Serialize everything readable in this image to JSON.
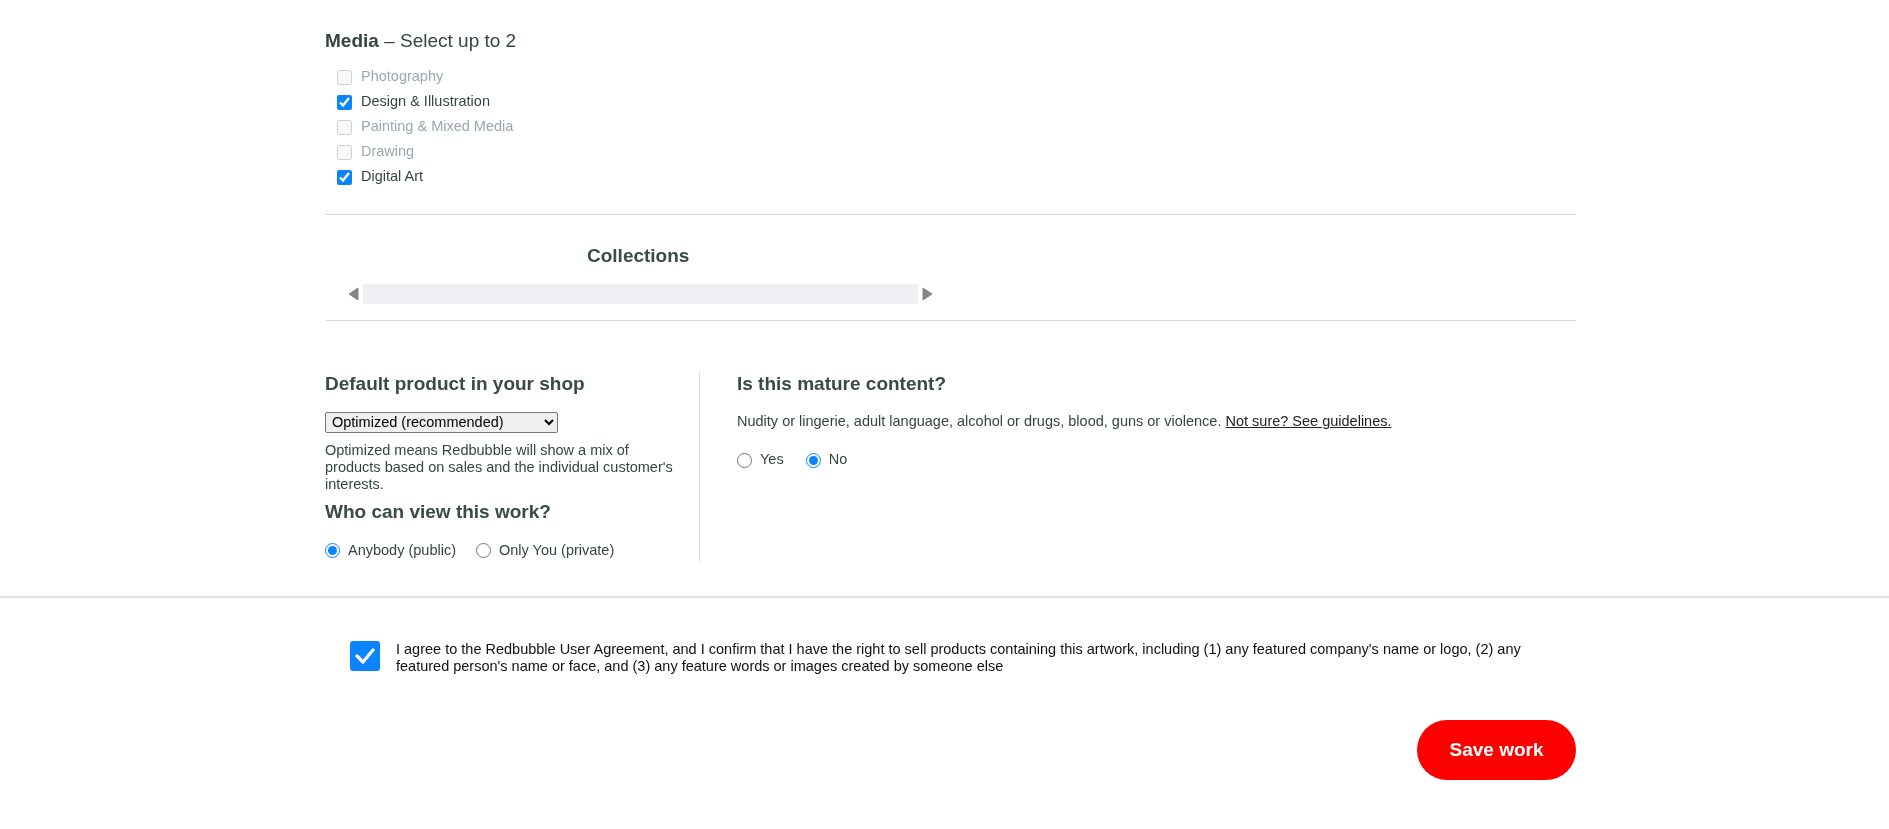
{
  "media": {
    "heading": "**Media** – Select up to 2",
    "options": [
      {
        "label": "Photography",
        "checked": false,
        "disabled": true
      },
      {
        "label": "Design & Illustration",
        "checked": true,
        "disabled": false
      },
      {
        "label": "Painting & Mixed Media",
        "checked": false,
        "disabled": true
      },
      {
        "label": "Drawing",
        "checked": false,
        "disabled": true
      },
      {
        "label": "Digital Art",
        "checked": true,
        "disabled": false
      }
    ]
  },
  "collections": {
    "heading": "Collections"
  },
  "default_product": {
    "heading": "Default product in your shop",
    "select_value": "Optimized (recommended)",
    "help": "Optimized means Redbubble will show a mix of products based on sales and the individual customer's interests."
  },
  "visibility": {
    "heading": "Who can view this work?",
    "options": [
      {
        "label": "Anybody (public)",
        "selected": true
      },
      {
        "label": "Only You (private)",
        "selected": false
      }
    ]
  },
  "mature": {
    "heading": "Is this mature content?",
    "description": "Nudity or lingerie, adult language, alcohol or drugs, blood, guns or violence.",
    "link": "Not sure? See guidelines.",
    "options": [
      {
        "label": "Yes",
        "selected": false
      },
      {
        "label": "No",
        "selected": true
      }
    ]
  },
  "agreement": {
    "checked": true,
    "text": "I agree to the Redbubble User Agreement, and I confirm that I have the right to sell products containing this artwork, including (1) any featured company's name or logo, (2) any featured person's name or face, and (3) any feature words or images created by someone else"
  },
  "save_button": "Save work"
}
